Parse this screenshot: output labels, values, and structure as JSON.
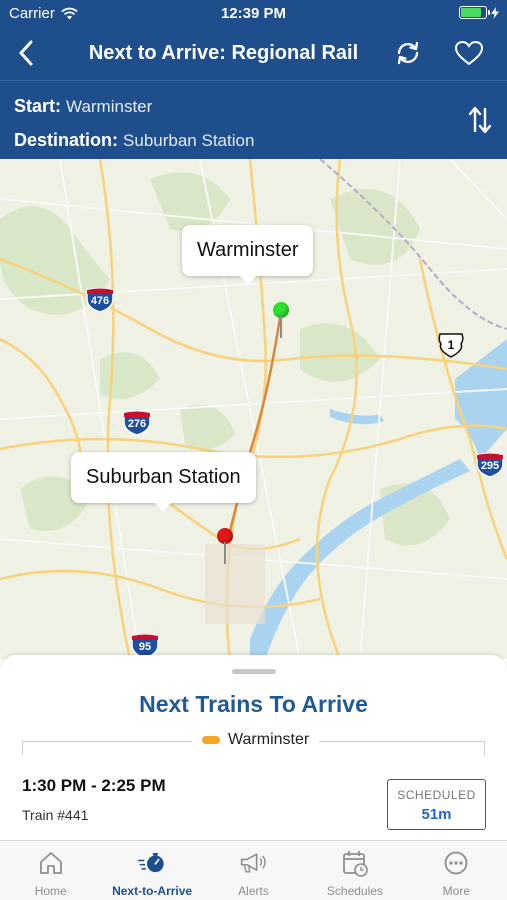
{
  "status_bar": {
    "carrier": "Carrier",
    "time": "12:39 PM",
    "battery_level": 0.85
  },
  "nav": {
    "title": "Next to Arrive: Regional Rail"
  },
  "route": {
    "start_label": "Start:",
    "start_value": "Warminster",
    "destination_label": "Destination:",
    "destination_value": "Suburban Station"
  },
  "map": {
    "origin_callout": "Warminster",
    "destination_callout": "Suburban Station",
    "shields": {
      "i476": "476",
      "i276": "276",
      "i95": "95",
      "i295": "295",
      "us1": "1"
    },
    "colors": {
      "origin_pin": "#2ee02e",
      "destination_pin": "#e01818"
    }
  },
  "sheet": {
    "title": "Next Trains To Arrive",
    "line_label": "Warminster",
    "line_color": "#f5a623",
    "trip": {
      "time_range": "1:30 PM - 2:25 PM",
      "train": "Train #441",
      "status": "SCHEDULED",
      "minutes": "51m"
    }
  },
  "tabs": [
    {
      "label": "Home",
      "icon": "home-icon"
    },
    {
      "label": "Next-to-Arrive",
      "icon": "stopwatch-icon",
      "active": true
    },
    {
      "label": "Alerts",
      "icon": "megaphone-icon"
    },
    {
      "label": "Schedules",
      "icon": "calendar-clock-icon"
    },
    {
      "label": "More",
      "icon": "more-icon"
    }
  ],
  "colors": {
    "brand": "#1f4e8c",
    "accent_title": "#1f5a96",
    "minutes": "#2066c4"
  }
}
